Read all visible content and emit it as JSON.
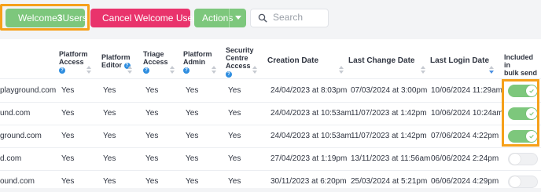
{
  "toolbar": {
    "welcome_label_pre": "Welcome ",
    "welcome_count": "3",
    "welcome_label_post": " Users",
    "cancel_label": "Cancel Welcome Users",
    "actions_label": "Actions",
    "search_placeholder": "Search"
  },
  "columns": {
    "platform_access": [
      "Platform",
      "Access"
    ],
    "platform_editor": [
      "Platform",
      "Editor"
    ],
    "triage_access": [
      "Triage",
      "Access"
    ],
    "platform_admin": [
      "Platform",
      "Admin"
    ],
    "security_centre_access": [
      "Security",
      "Centre",
      "Access"
    ],
    "creation_date": "Creation Date",
    "last_change_date": "Last Change Date",
    "last_login_date": "Last Login Date",
    "included_in_bulk_send": [
      "Included in",
      "bulk send"
    ],
    "help_glyph": "?"
  },
  "rows": [
    {
      "email": "playground.com",
      "platform_access": "Yes",
      "platform_editor": "Yes",
      "triage_access": "Yes",
      "platform_admin": "Yes",
      "security_centre_access": "Yes",
      "creation_date": "24/04/2023 at 8:03pm",
      "last_change_date": "07/03/2024 at 3:00pm",
      "last_login_date": "10/06/2024 11:29am",
      "included": true
    },
    {
      "email": "und.com",
      "platform_access": "Yes",
      "platform_editor": "Yes",
      "triage_access": "Yes",
      "platform_admin": "Yes",
      "security_centre_access": "Yes",
      "creation_date": "24/04/2023 at 10:53am",
      "last_change_date": "11/07/2023 at 1:42pm",
      "last_login_date": "10/06/2024 10:24am",
      "included": true
    },
    {
      "email": "ground.com",
      "platform_access": "Yes",
      "platform_editor": "Yes",
      "triage_access": "Yes",
      "platform_admin": "Yes",
      "security_centre_access": "Yes",
      "creation_date": "24/04/2023 at 10:53am",
      "last_change_date": "11/07/2023 at 1:42pm",
      "last_login_date": "07/06/2024 4:22pm",
      "included": true
    },
    {
      "email": "d.com",
      "platform_access": "Yes",
      "platform_editor": "Yes",
      "triage_access": "Yes",
      "platform_admin": "Yes",
      "security_centre_access": "Yes",
      "creation_date": "27/04/2023 at 1:19pm",
      "last_change_date": "13/11/2023 at 11:56am",
      "last_login_date": "06/06/2024 2:24pm",
      "included": false
    },
    {
      "email": "ound.com",
      "platform_access": "Yes",
      "platform_editor": "Yes",
      "triage_access": "Yes",
      "platform_admin": "Yes",
      "security_centre_access": "Yes",
      "creation_date": "30/11/2023 at 6:20pm",
      "last_change_date": "25/03/2024 at 5:21pm",
      "last_login_date": "06/06/2024 4:29pm",
      "included": false
    }
  ],
  "colors": {
    "green": "#7dc77c",
    "pink": "#e9336c",
    "highlight": "#f6a01a",
    "help_blue": "#2f8ee0"
  }
}
